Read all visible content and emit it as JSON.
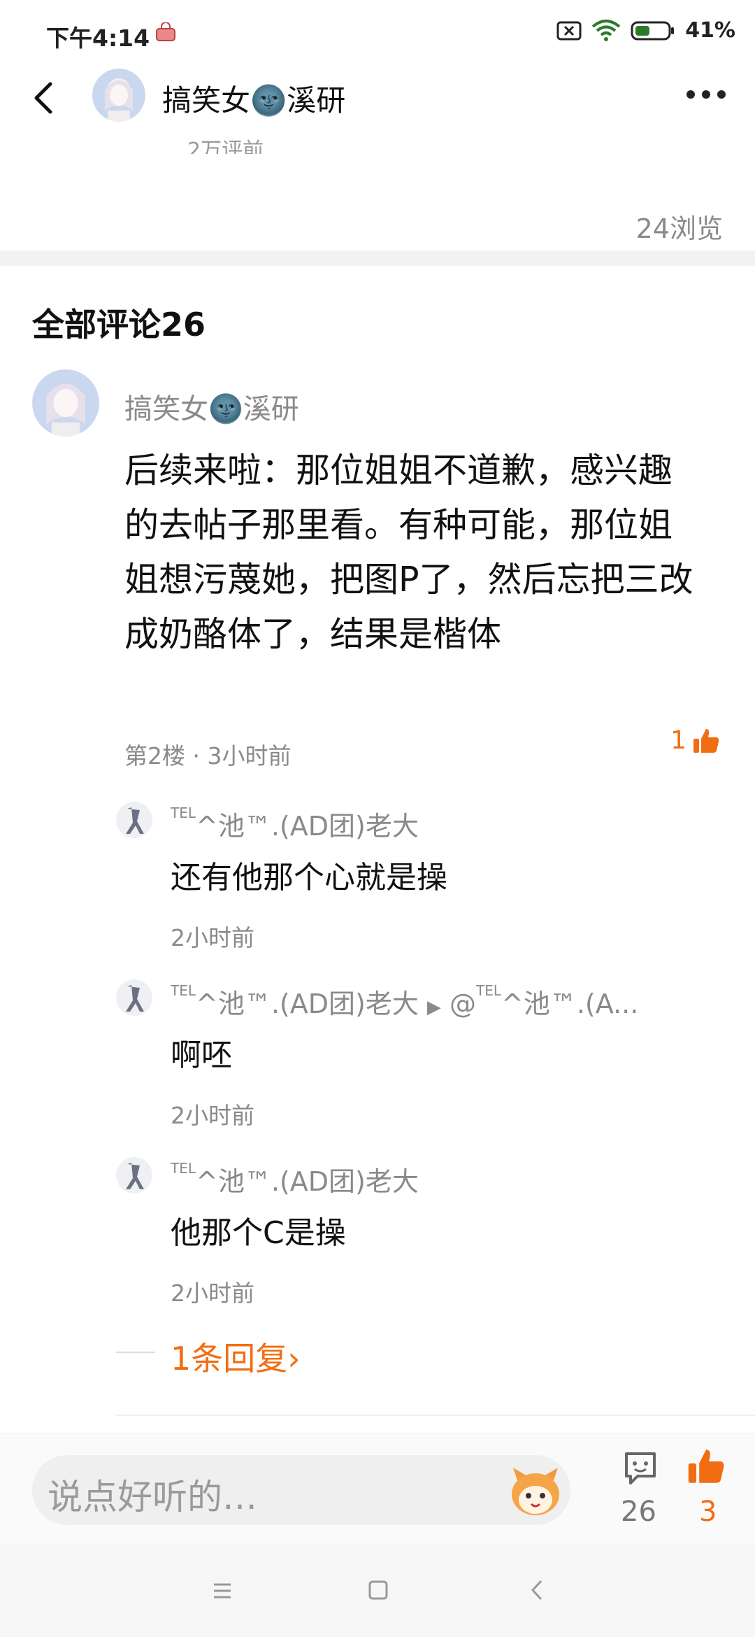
{
  "status_bar": {
    "time": "下午4:14",
    "battery": "41%"
  },
  "header": {
    "title": "搞笑女🌚溪研"
  },
  "post": {
    "partial_text": "2万评前",
    "views": "24浏览"
  },
  "comments_section": {
    "title": "全部评论26"
  },
  "main_comment": {
    "user": "搞笑女🌚溪研",
    "text": "后续来啦：那位姐姐不道歉，感兴趣的去帖子那里看。有种可能，那位姐姐想污蔑她，把图P了，然后忘把三改成奶酪体了，结果是楷体",
    "meta": "第2楼 · 3小时前",
    "likes": "1"
  },
  "replies": [
    {
      "sup": "TEL",
      "user": "^池™.(AD团)老大",
      "target": "",
      "text": "还有他那个心就是操",
      "time": "2小时前"
    },
    {
      "sup": "TEL",
      "user": "^池™.(AD团)老大",
      "target_sup": "TEL",
      "target": "^池™.(A...",
      "text": "啊呸",
      "time": "2小时前"
    },
    {
      "sup": "TEL",
      "user": "^池™.(AD团)老大",
      "target": "",
      "text": "他那个C是操",
      "time": "2小时前"
    }
  ],
  "more_replies": "1条回复›",
  "input_bar": {
    "placeholder": "说点好听的…",
    "comment_count": "26",
    "like_count": "3"
  },
  "colors": {
    "accent": "#f26d12",
    "muted": "#8a8a8a"
  }
}
